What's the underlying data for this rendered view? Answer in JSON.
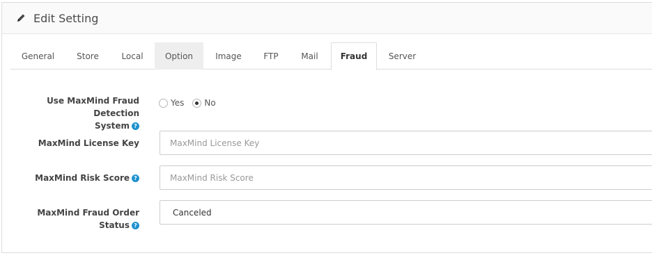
{
  "header": {
    "title": "Edit Setting",
    "icon": "pencil-icon"
  },
  "tabs": [
    {
      "label": "General"
    },
    {
      "label": "Store"
    },
    {
      "label": "Local"
    },
    {
      "label": "Option"
    },
    {
      "label": "Image"
    },
    {
      "label": "FTP"
    },
    {
      "label": "Mail"
    },
    {
      "label": "Fraud"
    },
    {
      "label": "Server"
    }
  ],
  "active_tab": "Fraud",
  "form": {
    "use_maxmind": {
      "label_line1": "Use MaxMind Fraud Detection",
      "label_line2": "System",
      "options": [
        "Yes",
        "No"
      ],
      "selected": "No"
    },
    "license_key": {
      "label": "MaxMind License Key",
      "placeholder": "MaxMind License Key",
      "value": ""
    },
    "risk_score": {
      "label": "MaxMind Risk Score",
      "placeholder": "MaxMind Risk Score",
      "value": ""
    },
    "order_status": {
      "label_line1": "MaxMind Fraud Order",
      "label_line2": "Status",
      "value": "Canceled"
    }
  },
  "colors": {
    "help_icon": "#1e91cf",
    "active_tab_border": "#dddddd"
  }
}
